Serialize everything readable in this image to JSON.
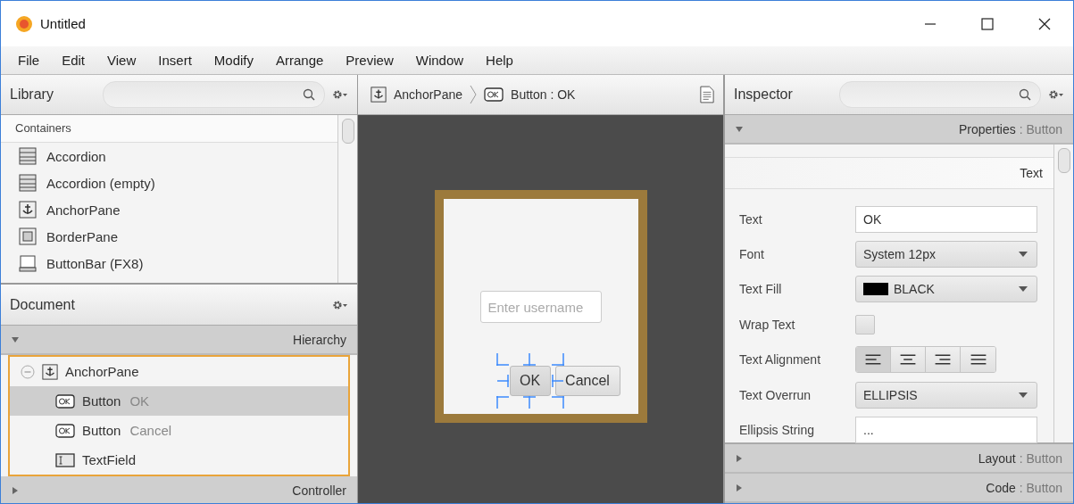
{
  "window": {
    "title": "Untitled"
  },
  "menu": [
    "File",
    "Edit",
    "View",
    "Insert",
    "Modify",
    "Arrange",
    "Preview",
    "Window",
    "Help"
  ],
  "library": {
    "title": "Library",
    "section": "Containers",
    "items": [
      {
        "kind": "accordion",
        "label": "Accordion"
      },
      {
        "kind": "accordion",
        "label": "Accordion  (empty)"
      },
      {
        "kind": "anchor",
        "label": "AnchorPane"
      },
      {
        "kind": "border",
        "label": "BorderPane"
      },
      {
        "kind": "buttonbar",
        "label": "ButtonBar  (FX8)"
      }
    ]
  },
  "document": {
    "title": "Document",
    "sections": [
      {
        "label": "Hierarchy",
        "expanded": true
      },
      {
        "label": "Controller",
        "expanded": false
      }
    ],
    "tree": [
      {
        "kind": "anchor",
        "type": "AnchorPane",
        "expanded": true,
        "selected": false,
        "children": [
          {
            "kind": "button",
            "type": "Button",
            "name": "OK",
            "selected": true
          },
          {
            "kind": "button",
            "type": "Button",
            "name": "Cancel",
            "selected": false
          },
          {
            "kind": "textfield",
            "type": "TextField",
            "selected": false
          }
        ]
      }
    ]
  },
  "breadcrumb": [
    {
      "kind": "anchor",
      "label": "AnchorPane"
    },
    {
      "kind": "button",
      "label": "Button : OK"
    }
  ],
  "canvas": {
    "field": {
      "placeholder": "Enter username"
    },
    "buttons": [
      {
        "label": "OK",
        "selected": true
      },
      {
        "label": "Cancel",
        "selected": false
      }
    ]
  },
  "inspector": {
    "title": "Inspector",
    "sections": [
      {
        "title": "Properties",
        "target": ": Button",
        "expanded": true
      },
      {
        "title": "Layout",
        "target": ": Button",
        "expanded": false
      },
      {
        "title": "Code",
        "target": ": Button",
        "expanded": false
      }
    ],
    "group": "Text",
    "rows": [
      {
        "kind": "text",
        "label": "Text",
        "value": "OK"
      },
      {
        "kind": "select",
        "label": "Font",
        "value": "System 12px"
      },
      {
        "kind": "color",
        "label": "Text Fill",
        "value": "BLACK",
        "color": "#000000"
      },
      {
        "kind": "checkbox",
        "label": "Wrap Text",
        "checked": false
      },
      {
        "kind": "alignment",
        "label": "Text Alignment",
        "options": [
          {
            "kind": "left",
            "selected": true
          },
          {
            "kind": "center",
            "selected": false
          },
          {
            "kind": "right",
            "selected": false
          },
          {
            "kind": "justify",
            "selected": false
          }
        ]
      },
      {
        "kind": "select",
        "label": "Text Overrun",
        "value": "ELLIPSIS"
      },
      {
        "kind": "text",
        "label": "Ellipsis String",
        "value": "..."
      }
    ]
  }
}
